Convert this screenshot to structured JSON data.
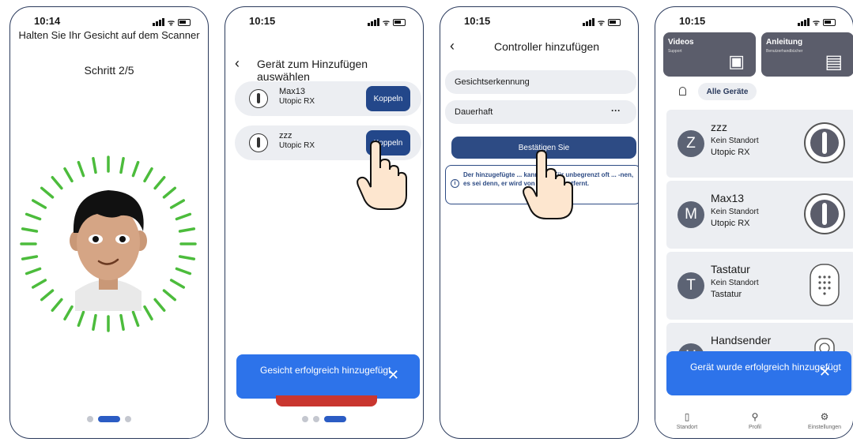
{
  "phone1": {
    "time": "10:14",
    "instruction": "Halten Sie Ihr Gesicht auf dem Scanner",
    "step": "Schritt 2/5"
  },
  "phone2": {
    "time": "10:15",
    "title": "Gerät zum Hinzufügen auswählen",
    "devices": [
      {
        "name": "Max13",
        "model": "Utopic RX",
        "button": "Koppeln"
      },
      {
        "name": "zzz",
        "model": "Utopic RX",
        "button": "Koppeln"
      }
    ],
    "toast": "Gesicht erfolgreich hinzugefügt"
  },
  "phone3": {
    "time": "10:15",
    "title": "Controller hinzufügen",
    "field1": "Gesichtserkennung",
    "field2": "Dauerhaft",
    "field2_more": "···",
    "confirm": "Bestätigen Sie",
    "note": "Der hinzugefügte ... kann Ihre Tür unbegrenzt oft ... -nen, es sei denn, er wird von einem ... entfernt."
  },
  "phone4": {
    "time": "10:15",
    "cards": [
      {
        "title": "Videos",
        "subtitle": "Support"
      },
      {
        "title": "Anleitung",
        "subtitle": "Benutzerhandbücher"
      }
    ],
    "filter": "Alle Geräte",
    "devices": [
      {
        "initial": "Z",
        "name": "zzz",
        "location": "Kein Standort",
        "model": "Utopic RX",
        "icon": "knob-icon"
      },
      {
        "initial": "M",
        "name": "Max13",
        "location": "Kein Standort",
        "model": "Utopic RX",
        "icon": "knob-icon"
      },
      {
        "initial": "T",
        "name": "Tastatur",
        "location": "Kein Standort",
        "model": "Tastatur",
        "icon": "keypad-icon"
      },
      {
        "initial": "H",
        "name": "Handsender",
        "location": "",
        "model": "",
        "icon": "remote-icon"
      }
    ],
    "toast": "Gerät wurde erfolgreich hinzugefügt",
    "nav": [
      "Standort",
      "Profil",
      "Einstellungen"
    ]
  },
  "colors": {
    "primary": "#2d73ea",
    "dark_button": "#23478a",
    "face_ring": "#4cbc3c"
  }
}
